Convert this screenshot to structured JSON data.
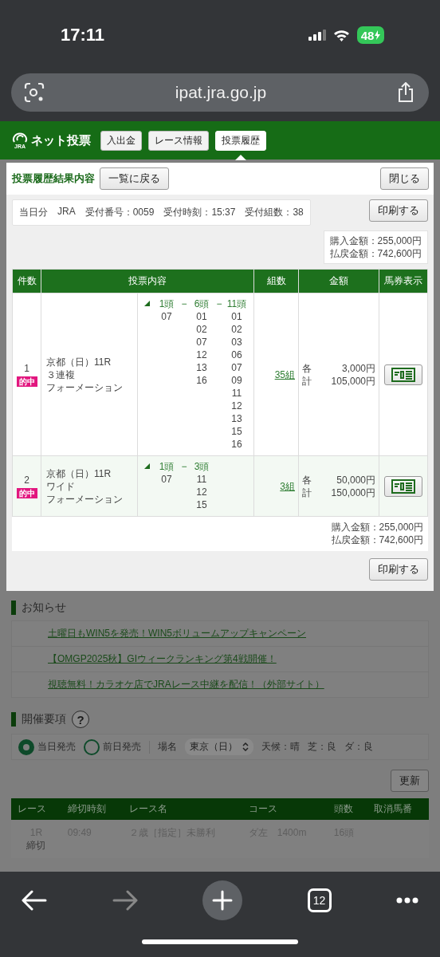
{
  "status_bar": {
    "time": "17:11",
    "battery": "48"
  },
  "browser": {
    "url": "ipat.jra.go.jp",
    "tab_count": "12"
  },
  "header": {
    "logo_mark": "JRA",
    "logo_text": "ネット投票",
    "nav": [
      {
        "label": "入出金",
        "selected": false
      },
      {
        "label": "レース情報",
        "selected": false
      },
      {
        "label": "投票履歴",
        "selected": true
      }
    ]
  },
  "modal": {
    "title": "投票履歴結果内容",
    "back_button": "一覧に戻る",
    "close_button": "閉じる",
    "receipt": [
      "当日分",
      "JRA",
      "受付番号：0059",
      "受付時刻：15:37",
      "受付組数：38"
    ],
    "print_button": "印刷する",
    "totals": [
      "購入金額：255,000円",
      "払戻金額：742,600円"
    ],
    "table": {
      "columns": [
        "件数",
        "投票内容",
        "組数",
        "金額",
        "馬券表示"
      ],
      "rows": [
        {
          "number": "1",
          "badge": "的中",
          "race": [
            "京都（日）11R",
            "３連複",
            "フォーメーション"
          ],
          "legs": [
            {
              "head": "1頭",
              "numbers": [
                "07"
              ]
            },
            {
              "separator": "−",
              "head": "6頭",
              "numbers": [
                "01",
                "02",
                "07",
                "12",
                "13",
                "16"
              ]
            },
            {
              "separator": "−",
              "head": "11頭",
              "numbers": [
                "01",
                "02",
                "03",
                "06",
                "07",
                "09",
                "11",
                "12",
                "13",
                "15",
                "16"
              ]
            }
          ],
          "combos": "35組",
          "each_label": "各",
          "each": "3,000円",
          "total_label": "計",
          "total": "105,000円"
        },
        {
          "number": "2",
          "badge": "的中",
          "race": [
            "京都（日）11R",
            "ワイド",
            "フォーメーション"
          ],
          "legs": [
            {
              "head": "1頭",
              "numbers": [
                "07"
              ]
            },
            {
              "separator": "−",
              "head": "3頭",
              "numbers": [
                "11",
                "12",
                "15"
              ]
            }
          ],
          "combos": "3組",
          "each_label": "各",
          "each": "50,000円",
          "total_label": "計",
          "total": "150,000円"
        }
      ]
    },
    "footer_totals": [
      "購入金額：255,000円",
      "払戻金額：742,600円"
    ],
    "footer_print_button": "印刷する"
  },
  "notices": {
    "title": "お知らせ",
    "links": [
      "土曜日もWIN5を発売！WIN5ボリュームアップキャンペーン",
      "【OMGP2025秋】GIウィークランキング第4戦開催！",
      "視聴無料！カラオケ店でJRAレース中継を配信！（外部サイト）"
    ]
  },
  "schedule": {
    "title": "開催要項",
    "help": "?",
    "options": [
      {
        "label": "当日発売",
        "selected": true
      },
      {
        "label": "前日発売",
        "selected": false
      }
    ],
    "venue_label": "場名",
    "venue": "東京（日）",
    "conditions": [
      "天候：晴",
      "芝：良",
      "ダ：良"
    ]
  },
  "refresh_button": "更新",
  "races": {
    "columns": [
      "レース",
      "締切時刻",
      "レース名",
      "コース",
      "頭数",
      "取消馬番"
    ],
    "rows": [
      {
        "race": "1R",
        "status": "締切",
        "time": "09:49",
        "name": "２歳［指定］未勝利",
        "course": "ダ左　1400m",
        "runners": "16頭"
      }
    ]
  }
}
